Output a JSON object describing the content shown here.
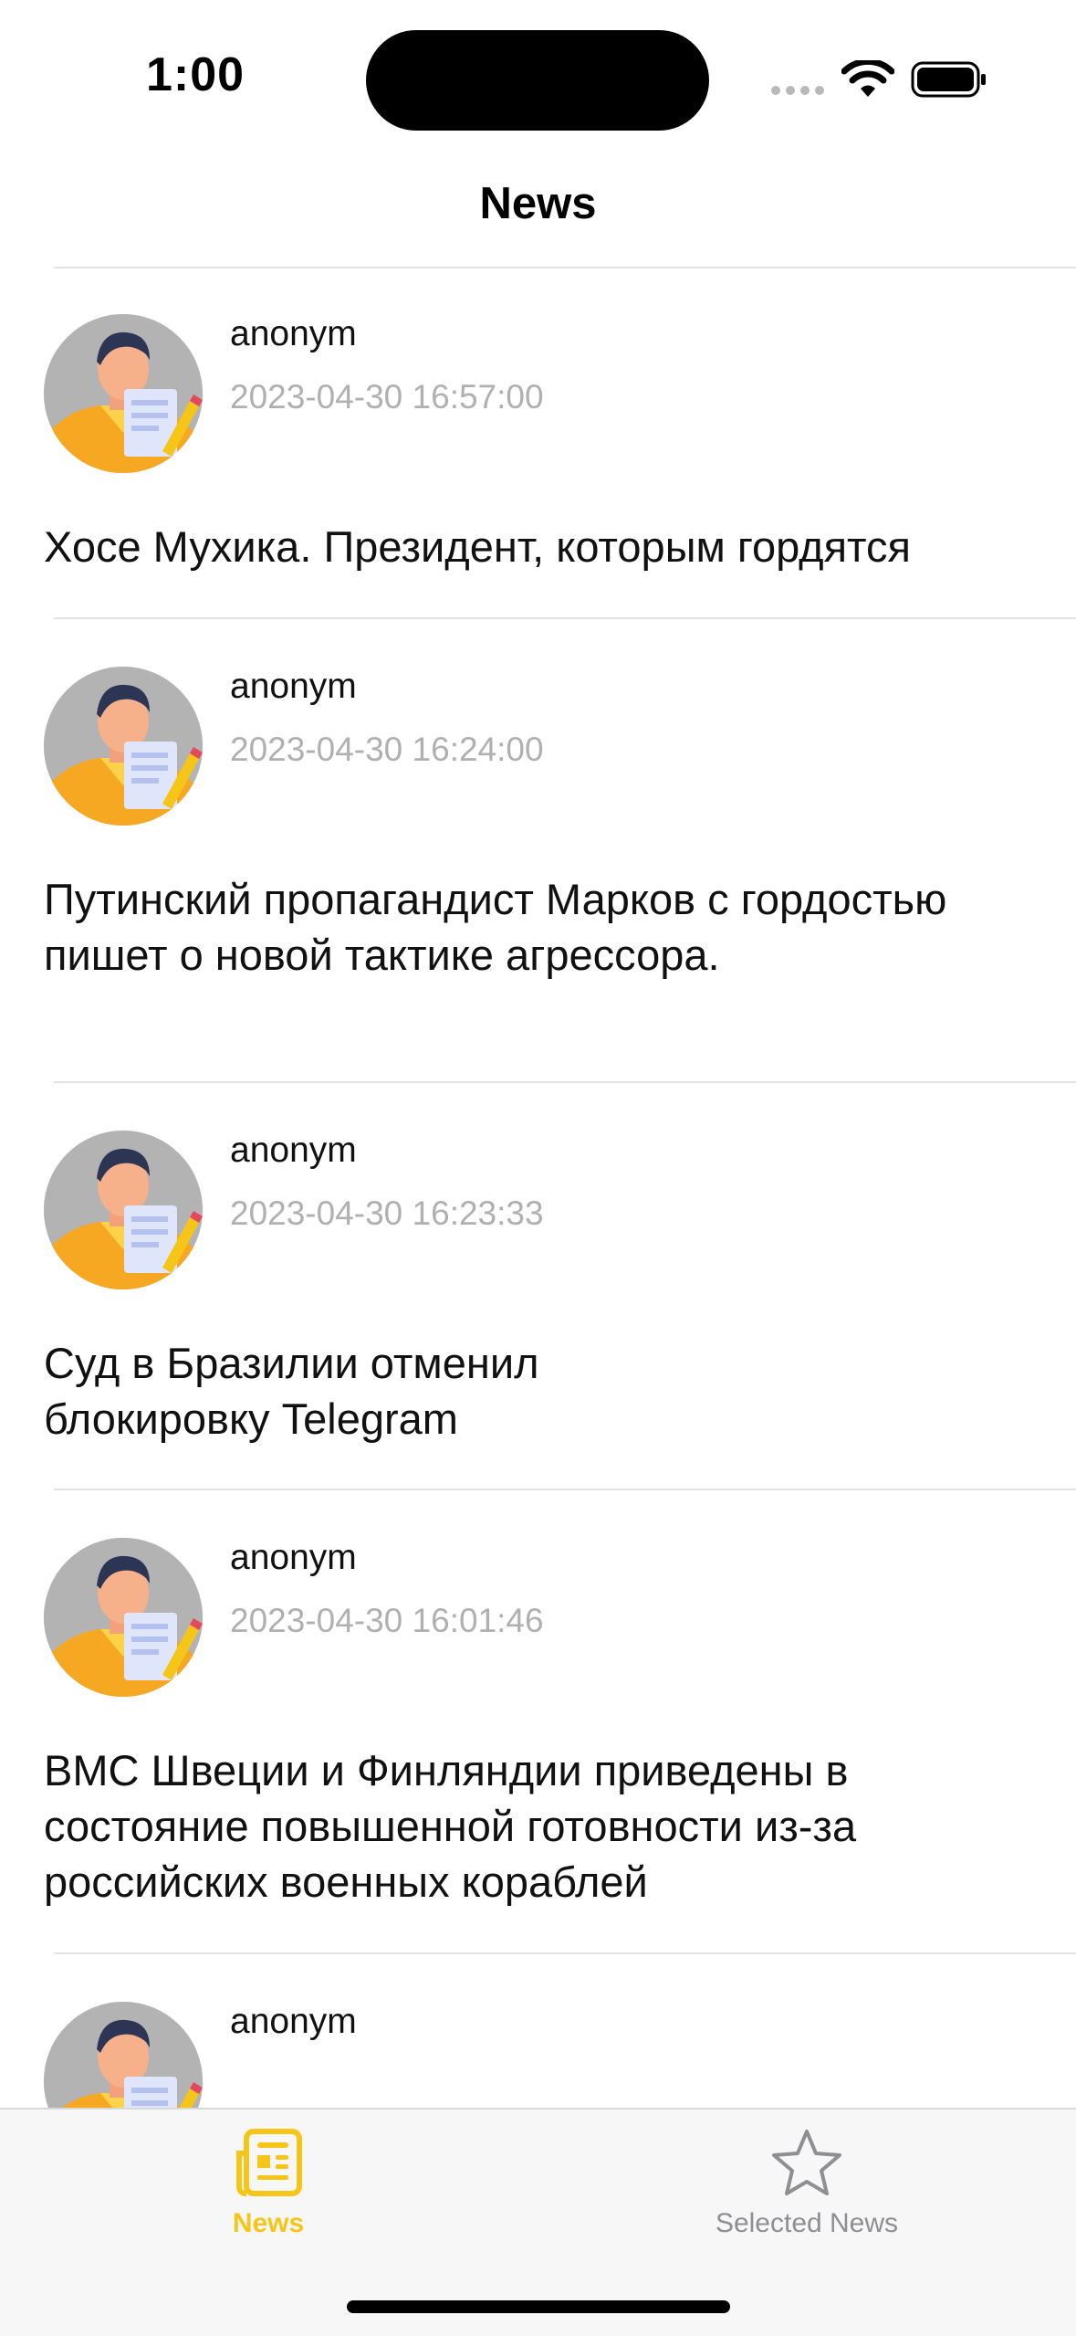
{
  "status_bar": {
    "time": "1:00"
  },
  "nav": {
    "title": "News"
  },
  "news": [
    {
      "author": "anonym",
      "date": "2023-04-30 16:57:00",
      "title": "Хосе Мухика. Президент, которым гордятся"
    },
    {
      "author": "anonym",
      "date": "2023-04-30 16:24:00",
      "title": "Путинский пропагандист Марков с гордостью пишет о новой тактике агрессора."
    },
    {
      "author": "anonym",
      "date": "2023-04-30 16:23:33",
      "title": "Суд в Бразилии отменил блокировку Telegram"
    },
    {
      "author": "anonym",
      "date": "2023-04-30 16:01:46",
      "title": "ВМС Швеции и Финляндии приведены в состояние повышенной готовности из-за российских военных кораблей"
    },
    {
      "author": "anonym",
      "date": "",
      "title": ""
    }
  ],
  "tabs": [
    {
      "label": "News",
      "icon": "newspaper-icon",
      "active": true
    },
    {
      "label": "Selected News",
      "icon": "star-icon",
      "active": false
    }
  ],
  "colors": {
    "accent": "#f5c518",
    "inactive": "#8e8e93",
    "secondary_text": "#b0b0b0",
    "divider": "#e3e3e3"
  }
}
